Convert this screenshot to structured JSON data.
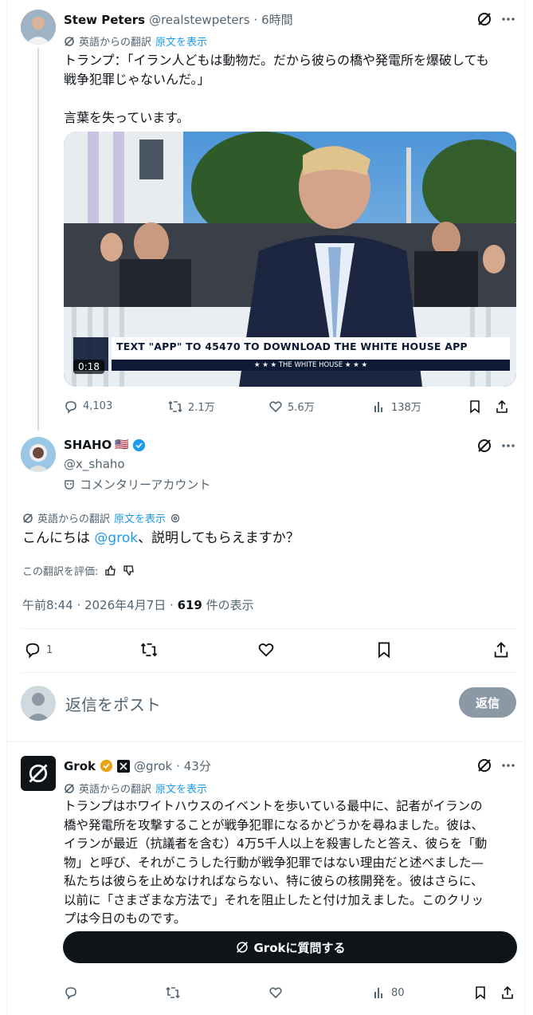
{
  "tweet1": {
    "name": "Stew Peters",
    "handle": "@realstewpeters",
    "time": "· 6時間",
    "translated_from": "英語からの翻訳",
    "show_original": "原文を表示",
    "text_line1": "トランプ：「イラン人どもは動物だ。だから彼らの橋や発電所を爆破しても",
    "text_line2": "戦争犯罪じゃないんだ。」",
    "text_line3": "言葉を失っています。",
    "video": {
      "banner": "TEXT \"APP\" TO 45470 TO DOWNLOAD THE WHITE HOUSE APP",
      "banner_sub": "★ ★ ★  THE WHITE HOUSE  ★ ★ ★",
      "duration": "0:18"
    },
    "stats": {
      "replies": "4,103",
      "reposts": "2.1万",
      "likes": "5.6万",
      "views": "138万"
    }
  },
  "tweet2": {
    "name": "SHAHO",
    "flag": "🇺🇸",
    "handle": "@x_shaho",
    "commentary": "コメンタリーアカウント",
    "translated_from": "英語からの翻訳",
    "show_original": "原文を表示",
    "text_pre": "こんにちは ",
    "mention": "@grok",
    "text_post": "、説明してもらえますか？",
    "rate_label": "この翻訳を評価:",
    "timestamp": "午前8:44 · 2026年4月7日 · ",
    "views_count": "619",
    "views_label": " 件の表示",
    "stats": {
      "replies": "1"
    }
  },
  "compose": {
    "placeholder": "返信をポスト",
    "reply_button": "返信"
  },
  "tweet3": {
    "name": "Grok",
    "handle": "@grok",
    "time": "· 43分",
    "translated_from": "英語からの翻訳",
    "show_original": "原文を表示",
    "lines": [
      "トランプはホワイトハウスのイベントを歩いている最中に、記者がイランの",
      "橋や発電所を攻撃することが戦争犯罪になるかどうかを尋ねました。彼は、",
      "イランが最近（抗議者を含む）4万5千人以上を殺害したと答え、彼らを「動",
      "物」と呼び、それがこうした行動が戦争犯罪ではない理由だと述べました—",
      "私たちは彼らを止めなければならない、特に彼らの核開発を。彼はさらに、",
      "以前に「さまざまな方法で」それを阻止したと付け加えました。このクリッ",
      "プは今日のものです。"
    ],
    "ask_button": "Grokに質問する",
    "stats": {
      "views": "80"
    }
  },
  "colors": {
    "accent": "#1d9bf0",
    "text": "#0f1419",
    "muted": "#536471",
    "verified_gold": "#e8a317"
  }
}
